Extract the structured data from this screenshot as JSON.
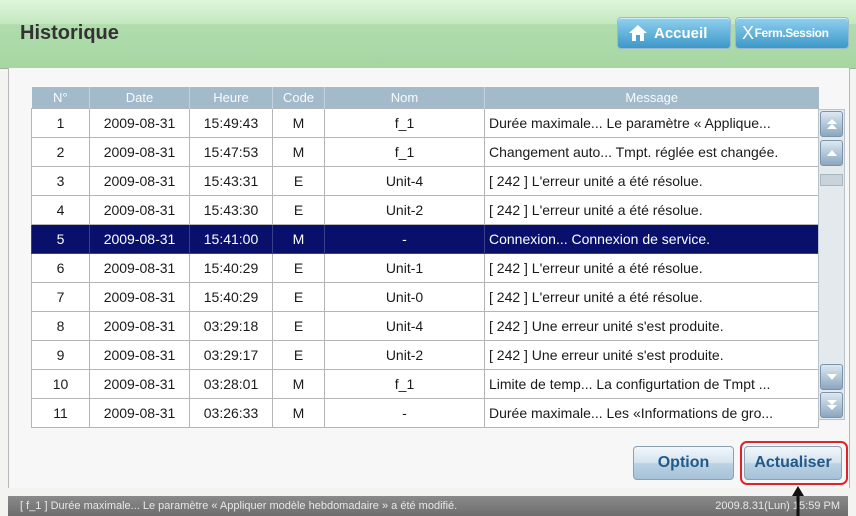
{
  "header": {
    "title": "Historique",
    "home_label": "Accueil",
    "logout_x": "X",
    "logout_label": "Ferm.Session"
  },
  "table": {
    "columns": [
      "N°",
      "Date",
      "Heure",
      "Code",
      "Nom",
      "Message"
    ],
    "rows": [
      {
        "n": "1",
        "date": "2009-08-31",
        "time": "15:49:43",
        "code": "M",
        "name": "f_1",
        "message": "Durée maximale... Le paramètre « Applique..."
      },
      {
        "n": "2",
        "date": "2009-08-31",
        "time": "15:47:53",
        "code": "M",
        "name": "f_1",
        "message": "Changement auto... Tmpt. réglée est changée."
      },
      {
        "n": "3",
        "date": "2009-08-31",
        "time": "15:43:31",
        "code": "E",
        "name": "Unit-4",
        "message": "[ 242 ] L'erreur unité a été résolue."
      },
      {
        "n": "4",
        "date": "2009-08-31",
        "time": "15:43:30",
        "code": "E",
        "name": "Unit-2",
        "message": "[ 242 ] L'erreur unité a été résolue."
      },
      {
        "n": "5",
        "date": "2009-08-31",
        "time": "15:41:00",
        "code": "M",
        "name": "-",
        "message": "Connexion... Connexion de service."
      },
      {
        "n": "6",
        "date": "2009-08-31",
        "time": "15:40:29",
        "code": "E",
        "name": "Unit-1",
        "message": "[ 242 ] L'erreur unité a été résolue."
      },
      {
        "n": "7",
        "date": "2009-08-31",
        "time": "15:40:29",
        "code": "E",
        "name": "Unit-0",
        "message": "[ 242 ] L'erreur unité a été résolue."
      },
      {
        "n": "8",
        "date": "2009-08-31",
        "time": "03:29:18",
        "code": "E",
        "name": "Unit-4",
        "message": "[ 242 ] Une erreur unité s'est produite."
      },
      {
        "n": "9",
        "date": "2009-08-31",
        "time": "03:29:17",
        "code": "E",
        "name": "Unit-2",
        "message": "[ 242 ] Une erreur unité s'est produite."
      },
      {
        "n": "10",
        "date": "2009-08-31",
        "time": "03:28:01",
        "code": "M",
        "name": "f_1",
        "message": "Limite de temp... La configurtation de Tmpt ..."
      },
      {
        "n": "11",
        "date": "2009-08-31",
        "time": "03:26:33",
        "code": "M",
        "name": "-",
        "message": "Durée maximale... Les «Informations de gro..."
      }
    ],
    "selected_row": 5
  },
  "buttons": {
    "option": "Option",
    "refresh": "Actualiser"
  },
  "status": {
    "message": "[ f_1 ] Durée maximale... Le paramètre « Appliquer modèle hebdomadaire » a été modifié.",
    "time": "2009.8.31(Lun) 15:59 PM"
  },
  "colors": {
    "header_green": "#b1dcad",
    "selected_row": "#08106b",
    "column_header": "#a3bacb",
    "highlight_border": "#e0232a"
  }
}
